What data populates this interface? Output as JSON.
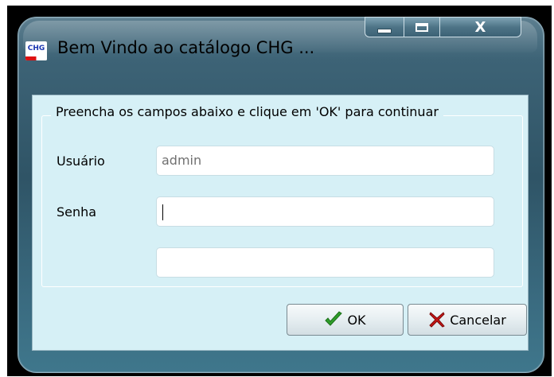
{
  "window": {
    "title": "Bem Vindo ao catálogo CHG ...",
    "logo_text": "CHG",
    "caption": {
      "minimize_icon": "minimize-icon",
      "maximize_icon": "maximize-icon",
      "close_label": "X"
    }
  },
  "form": {
    "group_label": "Preencha os campos abaixo e clique em 'OK' para continuar",
    "fields": {
      "user": {
        "label": "Usuário",
        "value": "admin"
      },
      "password": {
        "label": "Senha",
        "value": ""
      },
      "extra": {
        "value": ""
      }
    }
  },
  "buttons": {
    "ok": {
      "label": "OK",
      "icon": "check-icon"
    },
    "cancel": {
      "label": "Cancelar",
      "icon": "x-icon"
    }
  },
  "colors": {
    "content_bg": "#d6f0f6",
    "frame": "#3d6376",
    "check": "#2e9d2a",
    "cancel_x": "#c81414"
  }
}
